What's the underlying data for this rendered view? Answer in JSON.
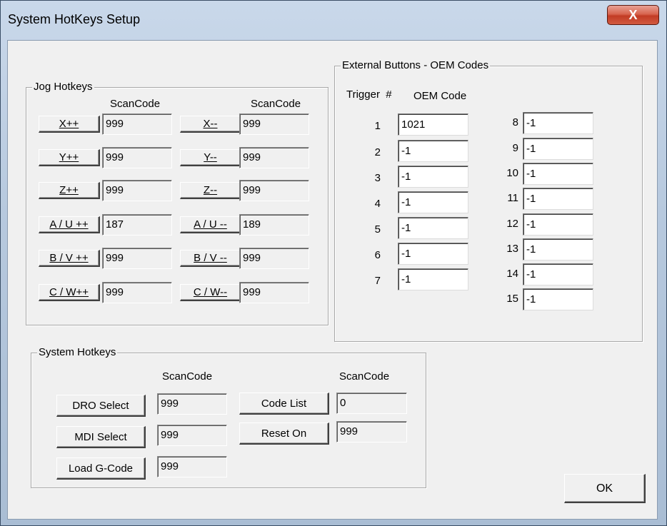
{
  "window": {
    "title": "System HotKeys Setup",
    "close_glyph": "X"
  },
  "jog": {
    "legend": "Jog Hotkeys",
    "scancode_header": "ScanCode",
    "left": [
      {
        "label": "X++",
        "code": "999"
      },
      {
        "label": "Y++",
        "code": "999"
      },
      {
        "label": "Z++",
        "code": "999"
      },
      {
        "label": "A / U ++",
        "code": "187"
      },
      {
        "label": "B / V ++",
        "code": "999"
      },
      {
        "label": "C / W++",
        "code": "999"
      }
    ],
    "right": [
      {
        "label": "X--",
        "code": "999"
      },
      {
        "label": "Y--",
        "code": "999"
      },
      {
        "label": "Z--",
        "code": "999"
      },
      {
        "label": "A / U --",
        "code": "189"
      },
      {
        "label": "B / V --",
        "code": "999"
      },
      {
        "label": "C / W--",
        "code": "999"
      }
    ]
  },
  "external": {
    "legend": "External Buttons - OEM Codes",
    "trigger_header": "Trigger  #",
    "oem_header": "OEM Code",
    "left": [
      {
        "n": "1",
        "code": "1021"
      },
      {
        "n": "2",
        "code": "-1"
      },
      {
        "n": "3",
        "code": "-1"
      },
      {
        "n": "4",
        "code": "-1"
      },
      {
        "n": "5",
        "code": "-1"
      },
      {
        "n": "6",
        "code": "-1"
      },
      {
        "n": "7",
        "code": "-1"
      }
    ],
    "right": [
      {
        "n": "8",
        "code": "-1"
      },
      {
        "n": "9",
        "code": "-1"
      },
      {
        "n": "10",
        "code": "-1"
      },
      {
        "n": "11",
        "code": "-1"
      },
      {
        "n": "12",
        "code": "-1"
      },
      {
        "n": "13",
        "code": "-1"
      },
      {
        "n": "14",
        "code": "-1"
      },
      {
        "n": "15",
        "code": "-1"
      }
    ]
  },
  "system": {
    "legend": "System Hotkeys",
    "scancode_header": "ScanCode",
    "dro_label": "DRO Select",
    "dro_code": "999",
    "mdi_label": "MDI Select",
    "mdi_code": "999",
    "load_label": "Load G-Code",
    "load_code": "999",
    "codelist_label": "Code List",
    "codelist_code": "0",
    "reset_label": "Reset On",
    "reset_code": "999"
  },
  "ok_label": "OK"
}
